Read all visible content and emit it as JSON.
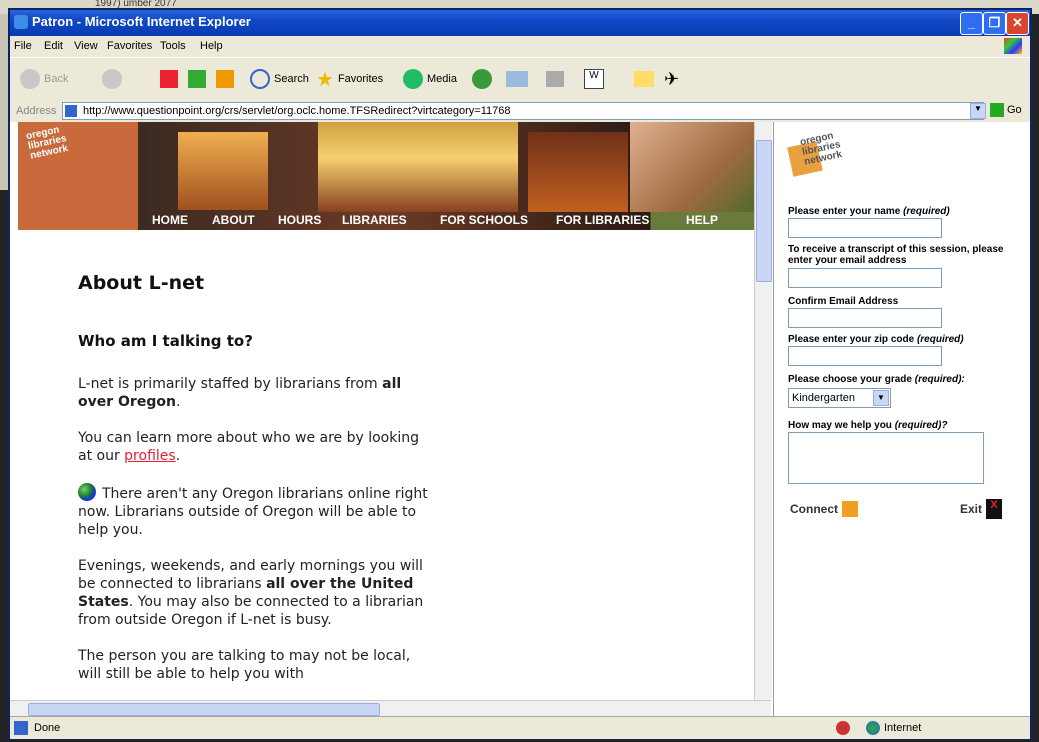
{
  "background_fragment": {
    "text": "1997)           umber 2077"
  },
  "window": {
    "title": "Patron - Microsoft Internet Explorer"
  },
  "menu": {
    "file": "File",
    "edit": "Edit",
    "view": "View",
    "favorites": "Favorites",
    "tools": "Tools",
    "help": "Help"
  },
  "toolbar": {
    "back": "Back",
    "search": "Search",
    "favorites": "Favorites",
    "media": "Media"
  },
  "address": {
    "label": "Address",
    "url": "http://www.questionpoint.org/crs/servlet/org.oclc.home.TFSRedirect?virtcategory=11768",
    "go": "Go"
  },
  "banner": {
    "logo_line1": "oregon",
    "logo_line2": "libraries",
    "logo_line3": "network"
  },
  "nav": {
    "home": "HOME",
    "about": "ABOUT",
    "hours": "HOURS",
    "libraries": "LIBRARIES",
    "for_schools": "FOR SCHOOLS",
    "for_libraries": "FOR LIBRARIES",
    "help": "HELP"
  },
  "article": {
    "title": "About L-net",
    "subtitle": "Who am I talking to?",
    "p1_a": "L-net is primarily staffed by librarians from ",
    "p1_b": "all over Oregon",
    "p1_c": ".",
    "p2_a": "You can learn more about who we are by looking at our ",
    "p2_link": "profiles",
    "p2_c": ".",
    "p3": "There aren't any Oregon librarians online right now. Librarians outside of Oregon will be able to help you.",
    "p4_a": "Evenings, weekends, and early mornings you will be connected to librarians ",
    "p4_b": "all over the United States",
    "p4_c": ". You may also be connected to a librarian from outside Oregon if L-net is busy.",
    "p5": "The person you are talking to may not be local, will still be able to help you with"
  },
  "form": {
    "logo_line1": "oregon",
    "logo_line2": "libraries",
    "logo_line3": "network",
    "name_label": "Please enter your name",
    "required": "(required)",
    "email_label": "To receive a transcript of this session, please enter your email address",
    "confirm_label": "Confirm Email Address",
    "zip_label": "Please enter your zip code",
    "grade_label": "Please choose your grade",
    "grade_required": "(required):",
    "grade_value": "Kindergarten",
    "help_label": "How may we help you",
    "help_required": "(required)?",
    "connect": "Connect",
    "exit": "Exit"
  },
  "status": {
    "text": "Done",
    "zone": "Internet"
  },
  "colors": {
    "titlebar": "#0a3cb0",
    "link": "#dd2233",
    "chrome": "#ece9d8"
  }
}
